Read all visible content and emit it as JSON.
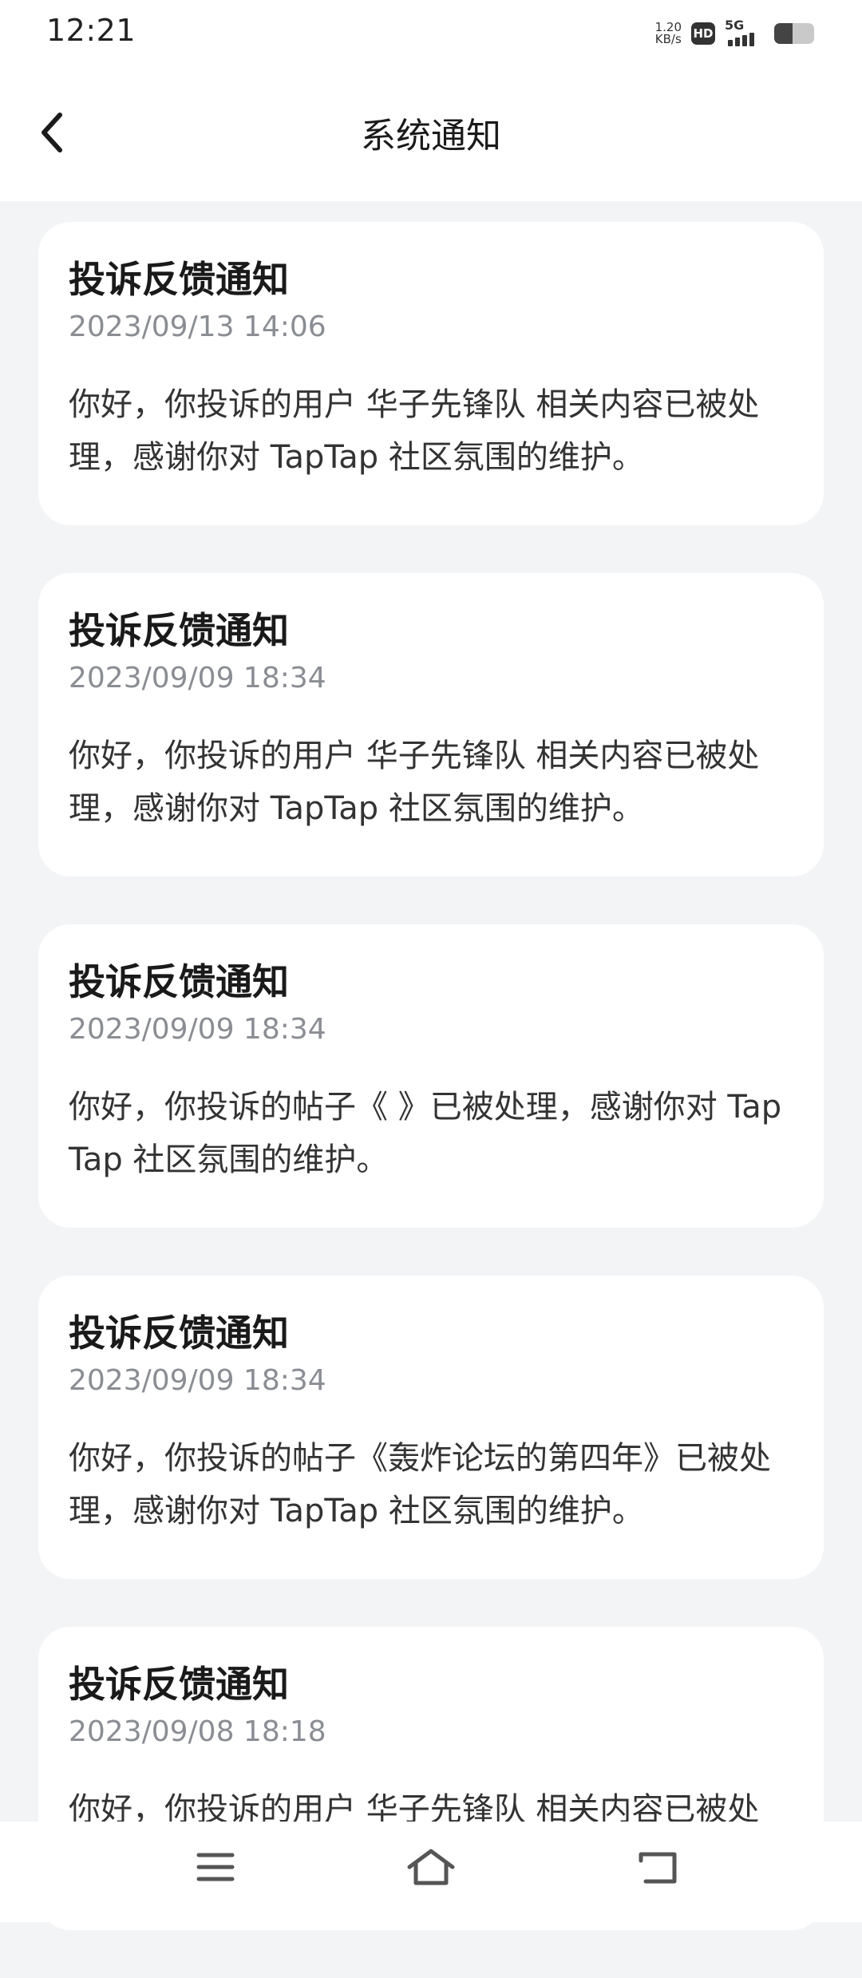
{
  "status_bar": {
    "time": "12:21",
    "net_speed_value": "1.20",
    "net_speed_unit": "KB/s",
    "hd_label": "HD",
    "network_type": "5G",
    "battery_level": 0.45,
    "icons": [
      "hd-icon",
      "signal-icon",
      "battery-icon"
    ]
  },
  "header": {
    "title": "系统通知",
    "back_icon": "chevron-left-icon"
  },
  "notifications": [
    {
      "title": "投诉反馈通知",
      "time": "2023/09/13 14:06",
      "body": "你好，你投诉的用户 华子先锋队 相关内容已被处理，感谢你对 TapTap 社区氛围的维护。"
    },
    {
      "title": "投诉反馈通知",
      "time": "2023/09/09 18:34",
      "body": "你好，你投诉的用户 华子先锋队 相关内容已被处理，感谢你对 TapTap 社区氛围的维护。"
    },
    {
      "title": "投诉反馈通知",
      "time": "2023/09/09 18:34",
      "body": "你好，你投诉的帖子《 》已被处理，感谢你对 TapTap 社区氛围的维护。"
    },
    {
      "title": "投诉反馈通知",
      "time": "2023/09/09 18:34",
      "body": "你好，你投诉的帖子《轰炸论坛的第四年》已被处理，感谢你对 TapTap 社区氛围的维护。"
    },
    {
      "title": "投诉反馈通知",
      "time": "2023/09/08 18:18",
      "body": "你好，你投诉的用户 华子先锋队 相关内容已被处理，感谢你对 TapTap 社区氛围的维护。"
    }
  ],
  "nav_bar": {
    "icons": [
      "menu-icon",
      "home-icon",
      "back-icon"
    ]
  }
}
